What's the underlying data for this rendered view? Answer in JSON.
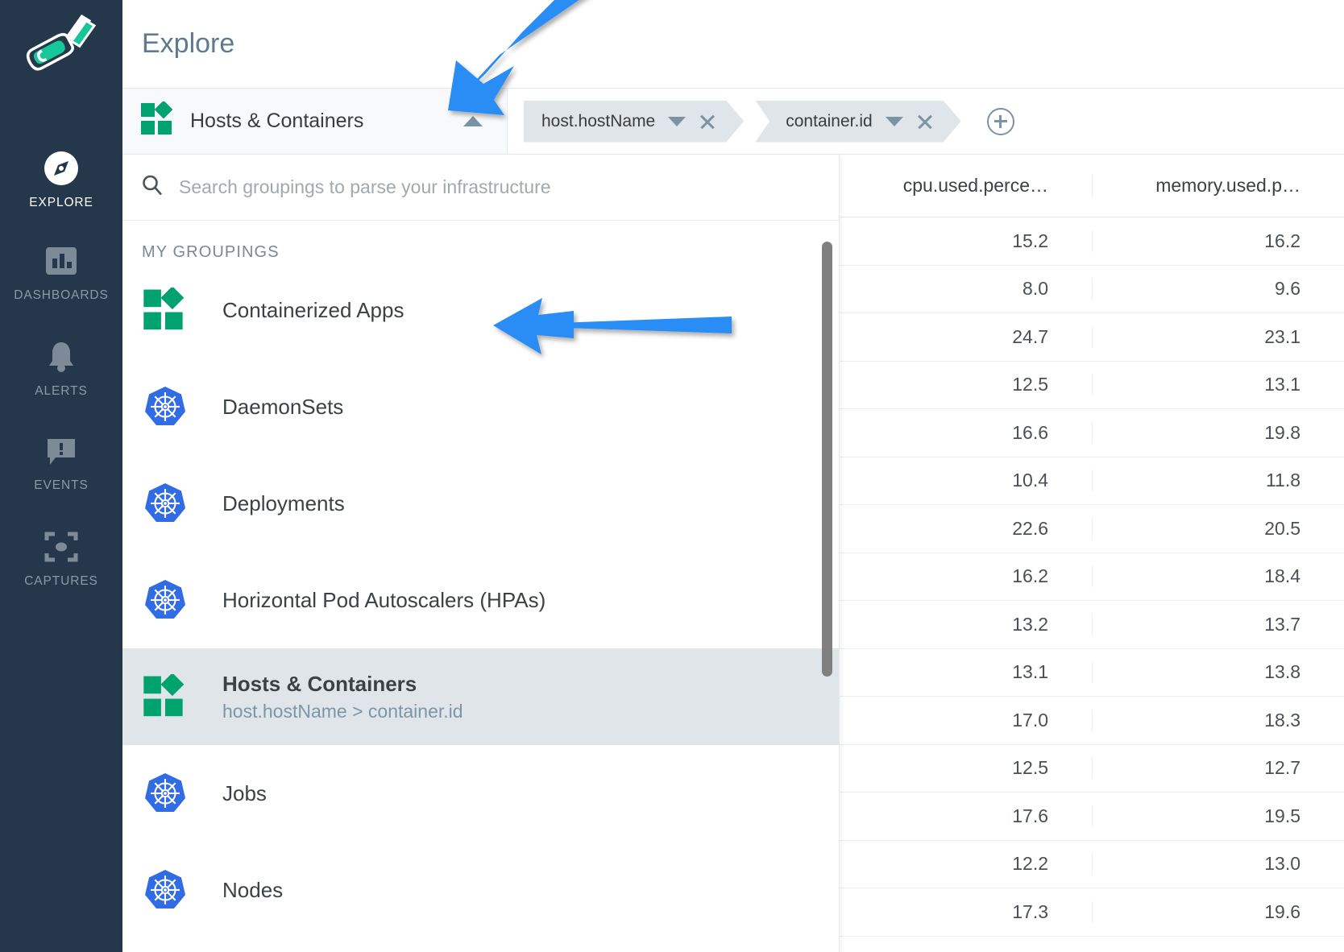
{
  "nav": {
    "brand_icon": "gardener-trowel-logo",
    "items": [
      {
        "label": "EXPLORE",
        "icon": "compass-icon",
        "active": true
      },
      {
        "label": "DASHBOARDS",
        "icon": "bar-chart-icon",
        "active": false
      },
      {
        "label": "ALERTS",
        "icon": "bell-icon",
        "active": false
      },
      {
        "label": "EVENTS",
        "icon": "speech-bubble-exclamation-icon",
        "active": false
      },
      {
        "label": "CAPTURES",
        "icon": "capture-frame-icon",
        "active": false
      }
    ]
  },
  "header": {
    "page_title": "Explore"
  },
  "grouping_bar": {
    "trigger_label": "Hosts & Containers",
    "trigger_icon": "sysdig-grouping-icon",
    "caret_icon": "chevron-up-icon",
    "breadcrumbs": [
      {
        "label": "host.hostName",
        "caret_icon": "chevron-down-icon",
        "close_icon": "close-icon"
      },
      {
        "label": "container.id",
        "caret_icon": "chevron-down-icon",
        "close_icon": "close-icon"
      }
    ],
    "add_button_icon": "plus-circle-icon"
  },
  "grouping_panel": {
    "search": {
      "icon": "search-icon",
      "placeholder": "Search groupings to parse your infrastructure",
      "value": ""
    },
    "section_title": "MY GROUPINGS",
    "items": [
      {
        "label": "Containerized Apps",
        "sub": "",
        "icon": "sysdig-grouping-icon",
        "selected": false
      },
      {
        "label": "DaemonSets",
        "sub": "",
        "icon": "kubernetes-icon",
        "selected": false
      },
      {
        "label": "Deployments",
        "sub": "",
        "icon": "kubernetes-icon",
        "selected": false
      },
      {
        "label": "Horizontal Pod Autoscalers (HPAs)",
        "sub": "",
        "icon": "kubernetes-icon",
        "selected": false
      },
      {
        "label": "Hosts & Containers",
        "sub": "host.hostName > container.id",
        "icon": "sysdig-grouping-icon",
        "selected": true
      },
      {
        "label": "Jobs",
        "sub": "",
        "icon": "kubernetes-icon",
        "selected": false
      },
      {
        "label": "Nodes",
        "sub": "",
        "icon": "kubernetes-icon",
        "selected": false
      }
    ]
  },
  "table": {
    "columns": [
      "cpu.used.perce…",
      "memory.used.p…"
    ],
    "rows": [
      [
        "15.2",
        "16.2"
      ],
      [
        "8.0",
        "9.6"
      ],
      [
        "24.7",
        "23.1"
      ],
      [
        "12.5",
        "13.1"
      ],
      [
        "16.6",
        "19.8"
      ],
      [
        "10.4",
        "11.8"
      ],
      [
        "22.6",
        "20.5"
      ],
      [
        "16.2",
        "18.4"
      ],
      [
        "13.2",
        "13.7"
      ],
      [
        "13.1",
        "13.8"
      ],
      [
        "17.0",
        "18.3"
      ],
      [
        "12.5",
        "12.7"
      ],
      [
        "17.6",
        "19.5"
      ],
      [
        "12.2",
        "13.0"
      ],
      [
        "17.3",
        "19.6"
      ]
    ]
  },
  "annotations": {
    "arrow_color": "#2a8cf5",
    "arrows": [
      {
        "name": "arrow-to-grouping-dropdown",
        "points_to": "grouping-trigger-caret"
      },
      {
        "name": "arrow-to-containerized-apps",
        "points_to": "group-row-containerized-apps"
      }
    ]
  },
  "colors": {
    "nav_background": "#25374a",
    "brand_green": "#00a26e",
    "kubernetes_blue": "#326ce5",
    "selected_row": "#dfe5e9",
    "title_text": "#5f7a8c"
  }
}
